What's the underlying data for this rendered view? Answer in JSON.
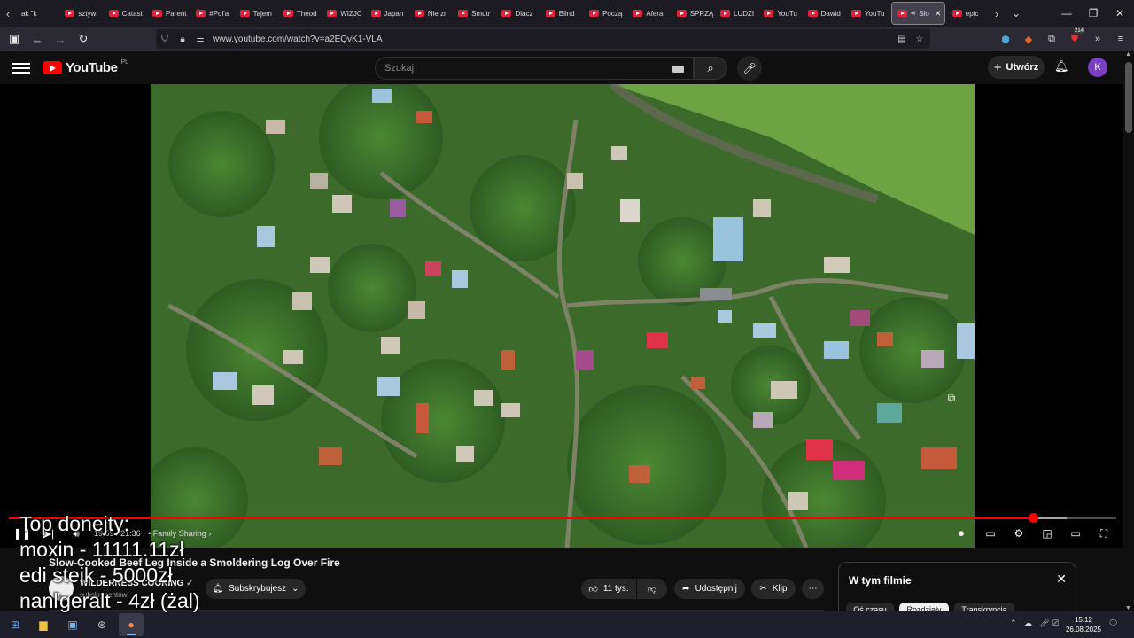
{
  "browser": {
    "tabs": [
      "ak \"k",
      "sztyw",
      "Catast",
      "Parent",
      "#Pol'a",
      "Tajem",
      "Theod",
      "WIZJC",
      "Japan",
      "Nie zr",
      "Smutr",
      "Dlacz",
      "Blind ",
      "Począ",
      "Afera",
      "SPRZĄ",
      "LUDZI",
      "YouTu",
      "Dawid",
      "YouTu"
    ],
    "active_tab": "Slo",
    "next_tab": "epic",
    "url": "www.youtube.com/watch?v=a2EQvK1-VLA",
    "extension_badge": "214"
  },
  "youtube": {
    "logo_text": "YouTube",
    "country_code": "PL",
    "search_placeholder": "Szukaj",
    "create_label": "Utwórz",
    "avatar_letter": "K"
  },
  "player": {
    "current_time": "19:59",
    "duration": "21:36",
    "chapter": "Family Sharing",
    "played_fraction": 0.925,
    "loaded_fraction": 0.955
  },
  "overlay_lines": [
    "Top donejty:",
    "moxin - 11111.11zł",
    "edi steik - 5000zł",
    "nanľgeralt - 4zł (żal)"
  ],
  "video": {
    "title": "Slow-Cooked Beef Leg Inside a Smoldering Log Over Fire",
    "channel": "WILDERNESS COOKING",
    "subscribers": "subskrybentów",
    "subscribe_label": "Subskrybujesz",
    "likes": "11 tys.",
    "share_label": "Udostępnij",
    "clip_label": "Klip"
  },
  "chapters_panel": {
    "heading": "W tym filmie",
    "tabs": [
      "Oś czasu",
      "Rozdziały",
      "Transkrypcja"
    ],
    "active_tab": "Rozdziały"
  },
  "taskbar": {
    "time": "15:12",
    "date": "26.08.2025"
  },
  "colors": {
    "accent_red": "#ff0000",
    "progress_red": "#f00",
    "avatar_purple": "#7b3fc4",
    "foliage_green": "#3d6b2c"
  }
}
